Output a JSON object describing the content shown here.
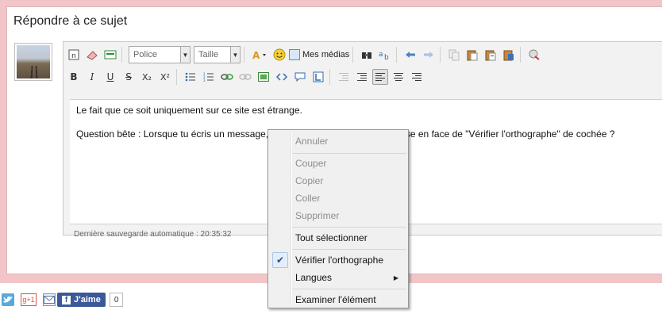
{
  "page": {
    "title": "Répondre à ce sujet"
  },
  "toolbar": {
    "font_select": "Police",
    "size_select": "Taille",
    "medias_label": "Mes médias",
    "bold": "B",
    "italic": "I",
    "underline": "U",
    "strike": "S",
    "subscript": "X₂",
    "superscript": "X²"
  },
  "editor": {
    "lines": [
      "Le fait que ce soit uniquement sur ce site est étrange.",
      "Question bête : Lorsque tu écris un message, clic droit sur un mot : As tu la case en face de \"Vérifier l'orthographe\" de cochée ?"
    ],
    "autosave": "Dernière sauvegarde automatique : 20:35:32"
  },
  "social": {
    "gplus": "g+1",
    "like_label": "J'aime",
    "like_count": "0"
  },
  "context_menu": {
    "items": [
      {
        "label": "Annuler",
        "disabled": true
      },
      {
        "label": "Couper",
        "disabled": true
      },
      {
        "label": "Copier",
        "disabled": true
      },
      {
        "label": "Coller",
        "disabled": true
      },
      {
        "label": "Supprimer",
        "disabled": true
      },
      {
        "label": "Tout sélectionner",
        "disabled": false
      },
      {
        "label": "Vérifier l'orthographe",
        "disabled": false,
        "checked": true
      },
      {
        "label": "Langues",
        "disabled": false,
        "submenu": true
      },
      {
        "label": "Examiner l'élément",
        "disabled": false
      }
    ]
  }
}
